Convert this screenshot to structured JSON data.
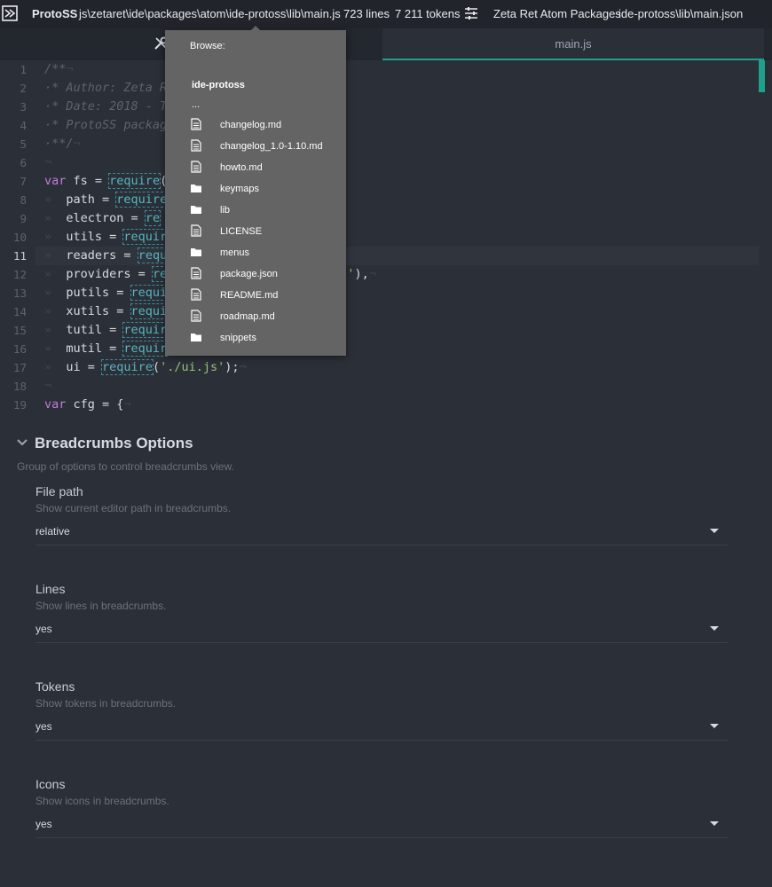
{
  "breadcrumbs": {
    "app_name": "ProtoSS",
    "path": "js\\zetaret\\ide\\packages\\atom\\ide-protoss\\lib\\main.js",
    "lines": "723 lines",
    "tokens": "7 211 tokens",
    "project": "Zeta Ret Atom Packages",
    "config": "ide-protoss\\lib\\main.json"
  },
  "tabs": [
    {
      "label": "",
      "icon": "tools-icon",
      "active": false
    },
    {
      "label": "main.js",
      "active": true
    }
  ],
  "editor": {
    "active_line": 11,
    "line_numbers": [
      "1",
      "2",
      "3",
      "4",
      "5",
      "6",
      "7",
      "8",
      "9",
      "10",
      "11",
      "12",
      "13",
      "14",
      "15",
      "16",
      "17",
      "18",
      "19"
    ],
    "lines": [
      [
        {
          "t": "/**",
          "c": "cm"
        },
        {
          "t": "¬",
          "c": "inv"
        }
      ],
      [
        {
          "t": "·* Author: Zeta Re",
          "c": "cm"
        }
      ],
      [
        {
          "t": "·* Date: 2018 - To",
          "c": "cm"
        }
      ],
      [
        {
          "t": "·* ProtoSS package",
          "c": "cm"
        }
      ],
      [
        {
          "t": "·**/",
          "c": "cm"
        },
        {
          "t": "¬",
          "c": "inv"
        }
      ],
      [
        {
          "t": "¬",
          "c": "inv"
        }
      ],
      [
        {
          "t": "var",
          "c": "kw"
        },
        {
          "t": " fs = "
        },
        {
          "t": "require",
          "c": "fn"
        },
        {
          "t": "('"
        }
      ],
      [
        {
          "t": "»",
          "c": "inv"
        },
        {
          "t": "  path = "
        },
        {
          "t": "require",
          "c": "fn"
        }
      ],
      [
        {
          "t": "»",
          "c": "inv"
        },
        {
          "t": "  electron = "
        },
        {
          "t": "re",
          "c": "fn"
        }
      ],
      [
        {
          "t": "»",
          "c": "inv"
        },
        {
          "t": "  utils = "
        },
        {
          "t": "requir",
          "c": "fn"
        }
      ],
      [
        {
          "t": "»",
          "c": "inv"
        },
        {
          "t": "  readers = "
        },
        {
          "t": "requ",
          "c": "fn"
        }
      ],
      [
        {
          "t": "»",
          "c": "inv"
        },
        {
          "t": "  providers = "
        },
        {
          "t": "re",
          "c": "fn"
        },
        {
          "t": "                 "
        },
        {
          "t": "iders.js'",
          "c": "str"
        },
        {
          "t": "),"
        },
        {
          "t": "¬",
          "c": "inv"
        }
      ],
      [
        {
          "t": "»",
          "c": "inv"
        },
        {
          "t": "  putils = "
        },
        {
          "t": "requi",
          "c": "fn"
        }
      ],
      [
        {
          "t": "»",
          "c": "inv"
        },
        {
          "t": "  xutils = "
        },
        {
          "t": "requi",
          "c": "fn"
        }
      ],
      [
        {
          "t": "»",
          "c": "inv"
        },
        {
          "t": "  tutil = "
        },
        {
          "t": "requir",
          "c": "fn"
        }
      ],
      [
        {
          "t": "»",
          "c": "inv"
        },
        {
          "t": "  mutil = "
        },
        {
          "t": "requir",
          "c": "fn"
        }
      ],
      [
        {
          "t": "»",
          "c": "inv"
        },
        {
          "t": "  ui = "
        },
        {
          "t": "require",
          "c": "fn"
        },
        {
          "t": "("
        },
        {
          "t": "'./ui.js'",
          "c": "str"
        },
        {
          "t": ");"
        },
        {
          "t": "¬",
          "c": "inv"
        }
      ],
      [
        {
          "t": "¬",
          "c": "inv"
        }
      ],
      [
        {
          "t": "var",
          "c": "kw"
        },
        {
          "t": " cfg = {"
        },
        {
          "t": "¬",
          "c": "inv"
        }
      ]
    ]
  },
  "dropdown": {
    "header": "Browse:",
    "folder": "ide-protoss",
    "separator": "...",
    "items": [
      {
        "label": "changelog.md",
        "icon": "file-icon"
      },
      {
        "label": "changelog_1.0-1.10.md",
        "icon": "file-icon"
      },
      {
        "label": "howto.md",
        "icon": "file-icon"
      },
      {
        "label": "keymaps",
        "icon": "folder-icon"
      },
      {
        "label": "lib",
        "icon": "folder-icon"
      },
      {
        "label": "LICENSE",
        "icon": "file-icon"
      },
      {
        "label": "menus",
        "icon": "folder-icon"
      },
      {
        "label": "package.json",
        "icon": "file-icon"
      },
      {
        "label": "README.md",
        "icon": "file-icon"
      },
      {
        "label": "roadmap.md",
        "icon": "file-icon"
      },
      {
        "label": "snippets",
        "icon": "folder-icon"
      }
    ]
  },
  "settings": {
    "title": "Breadcrumbs Options",
    "description": "Group of options to control breadcrumbs view.",
    "items": [
      {
        "title": "File path",
        "description": "Show current editor path in breadcrumbs.",
        "value": "relative"
      },
      {
        "title": "Lines",
        "description": "Show lines in breadcrumbs.",
        "value": "yes"
      },
      {
        "title": "Tokens",
        "description": "Show tokens in breadcrumbs.",
        "value": "yes"
      },
      {
        "title": "Icons",
        "description": "Show icons in breadcrumbs.",
        "value": "yes"
      }
    ]
  },
  "colors": {
    "accent": "#1fa08c",
    "background": "#2b2f37",
    "dropdown_bg": "#646464"
  }
}
